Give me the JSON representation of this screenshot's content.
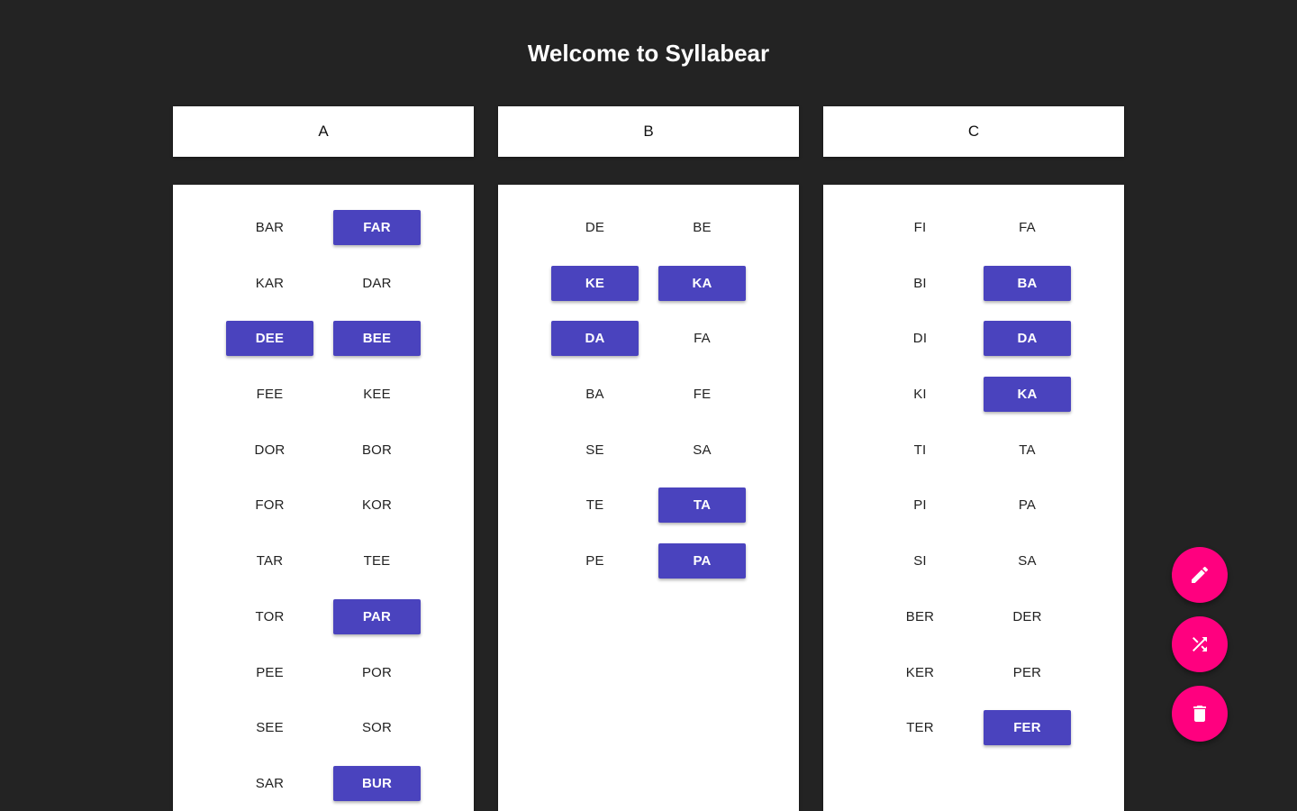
{
  "title": "Welcome to Syllabear",
  "colors": {
    "background": "#232323",
    "selected": "#4a43be",
    "fab": "#ff007f"
  },
  "columns": [
    {
      "header": "A",
      "chips": [
        {
          "label": "BAR",
          "selected": false
        },
        {
          "label": "FAR",
          "selected": true
        },
        {
          "label": "KAR",
          "selected": false
        },
        {
          "label": "DAR",
          "selected": false
        },
        {
          "label": "DEE",
          "selected": true
        },
        {
          "label": "BEE",
          "selected": true
        },
        {
          "label": "FEE",
          "selected": false
        },
        {
          "label": "KEE",
          "selected": false
        },
        {
          "label": "DOR",
          "selected": false
        },
        {
          "label": "BOR",
          "selected": false
        },
        {
          "label": "FOR",
          "selected": false
        },
        {
          "label": "KOR",
          "selected": false
        },
        {
          "label": "TAR",
          "selected": false
        },
        {
          "label": "TEE",
          "selected": false
        },
        {
          "label": "TOR",
          "selected": false
        },
        {
          "label": "PAR",
          "selected": true
        },
        {
          "label": "PEE",
          "selected": false
        },
        {
          "label": "POR",
          "selected": false
        },
        {
          "label": "SEE",
          "selected": false
        },
        {
          "label": "SOR",
          "selected": false
        },
        {
          "label": "SAR",
          "selected": false
        },
        {
          "label": "BUR",
          "selected": true
        }
      ]
    },
    {
      "header": "B",
      "chips": [
        {
          "label": "DE",
          "selected": false
        },
        {
          "label": "BE",
          "selected": false
        },
        {
          "label": "KE",
          "selected": true
        },
        {
          "label": "KA",
          "selected": true
        },
        {
          "label": "DA",
          "selected": true
        },
        {
          "label": "FA",
          "selected": false
        },
        {
          "label": "BA",
          "selected": false
        },
        {
          "label": "FE",
          "selected": false
        },
        {
          "label": "SE",
          "selected": false
        },
        {
          "label": "SA",
          "selected": false
        },
        {
          "label": "TE",
          "selected": false
        },
        {
          "label": "TA",
          "selected": true
        },
        {
          "label": "PE",
          "selected": false
        },
        {
          "label": "PA",
          "selected": true
        }
      ]
    },
    {
      "header": "C",
      "chips": [
        {
          "label": "FI",
          "selected": false
        },
        {
          "label": "FA",
          "selected": false
        },
        {
          "label": "BI",
          "selected": false
        },
        {
          "label": "BA",
          "selected": true
        },
        {
          "label": "DI",
          "selected": false
        },
        {
          "label": "DA",
          "selected": true
        },
        {
          "label": "KI",
          "selected": false
        },
        {
          "label": "KA",
          "selected": true
        },
        {
          "label": "TI",
          "selected": false
        },
        {
          "label": "TA",
          "selected": false
        },
        {
          "label": "PI",
          "selected": false
        },
        {
          "label": "PA",
          "selected": false
        },
        {
          "label": "SI",
          "selected": false
        },
        {
          "label": "SA",
          "selected": false
        },
        {
          "label": "BER",
          "selected": false
        },
        {
          "label": "DER",
          "selected": false
        },
        {
          "label": "KER",
          "selected": false
        },
        {
          "label": "PER",
          "selected": false
        },
        {
          "label": "TER",
          "selected": false
        },
        {
          "label": "FER",
          "selected": true
        }
      ]
    }
  ],
  "fabs": [
    {
      "name": "edit-button",
      "icon": "pencil-icon"
    },
    {
      "name": "shuffle-button",
      "icon": "shuffle-icon"
    },
    {
      "name": "delete-button",
      "icon": "trash-icon"
    }
  ]
}
